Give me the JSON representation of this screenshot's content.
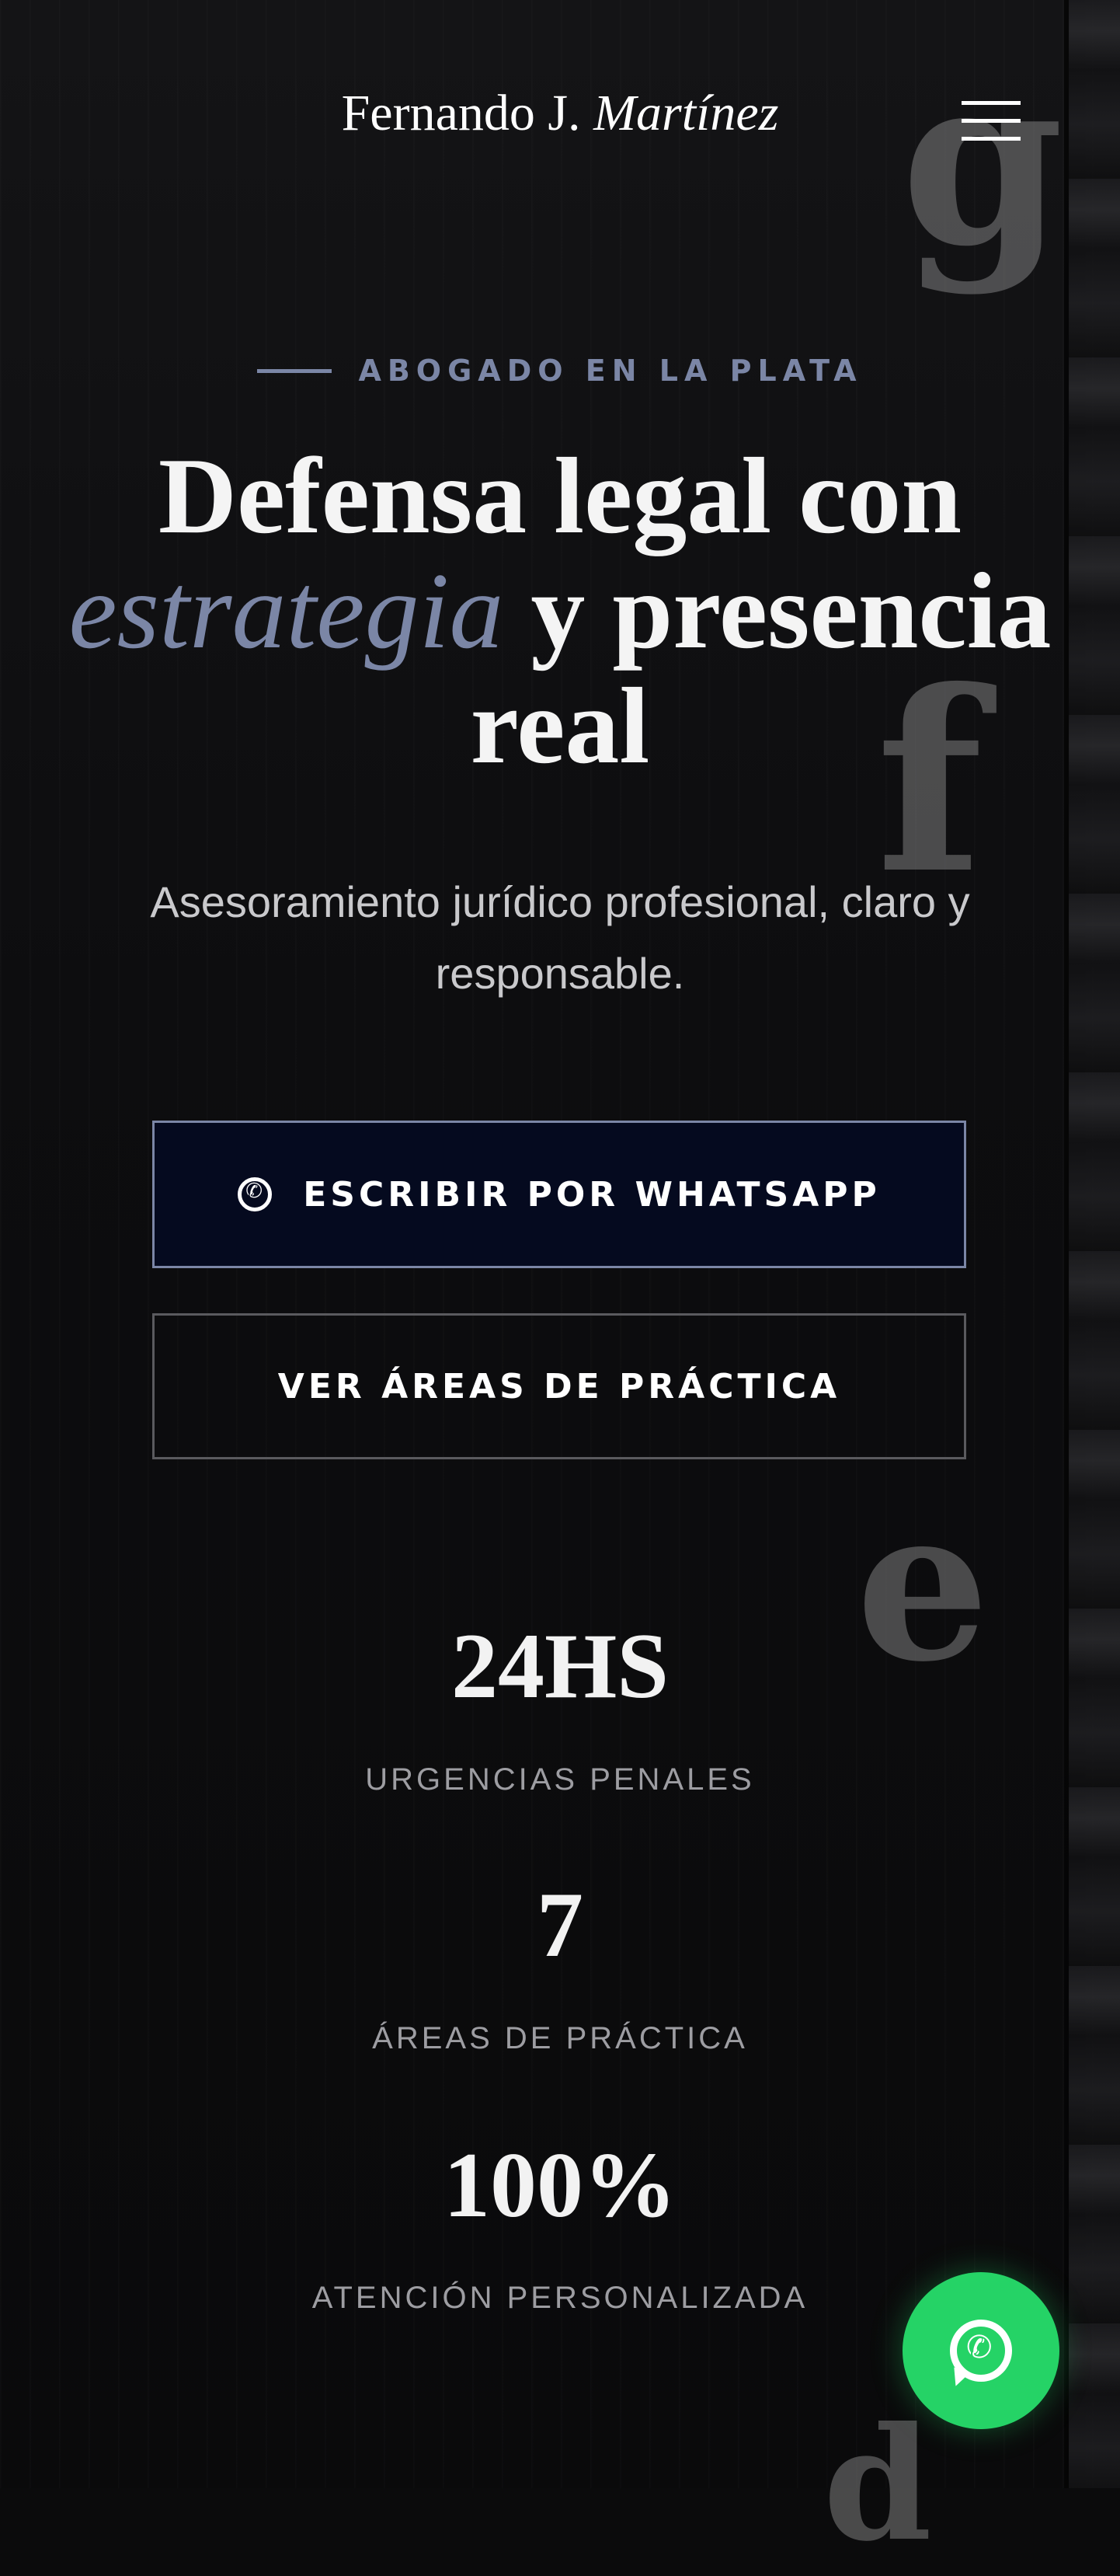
{
  "header": {
    "brand_first": "Fernando J.",
    "brand_italic": "Martínez",
    "menu_icon": "hamburger-menu-icon"
  },
  "hero": {
    "eyebrow": "ABOGADO EN LA PLATA",
    "title_line1": "Defensa legal con",
    "title_accent": "estrategia",
    "title_rest": "y presencia real",
    "subtitle": "Asesoramiento jurídico profesional, claro y responsable.",
    "accent_color": "#7b86a6"
  },
  "buttons": {
    "primary_label": "ESCRIBIR POR WHATSAPP",
    "primary_icon": "whatsapp-icon",
    "secondary_label": "VER ÁREAS DE PRÁCTICA"
  },
  "stats": [
    {
      "value": "24HS",
      "label": "URGENCIAS PENALES"
    },
    {
      "value": "7",
      "label": "ÁREAS DE PRÁCTICA"
    },
    {
      "value": "100%",
      "label": "ATENCIÓN PERSONALIZADA"
    }
  ],
  "fab": {
    "icon": "whatsapp-icon",
    "color": "#25d366"
  },
  "decor_letters": [
    "g",
    "f",
    "e",
    "d"
  ]
}
